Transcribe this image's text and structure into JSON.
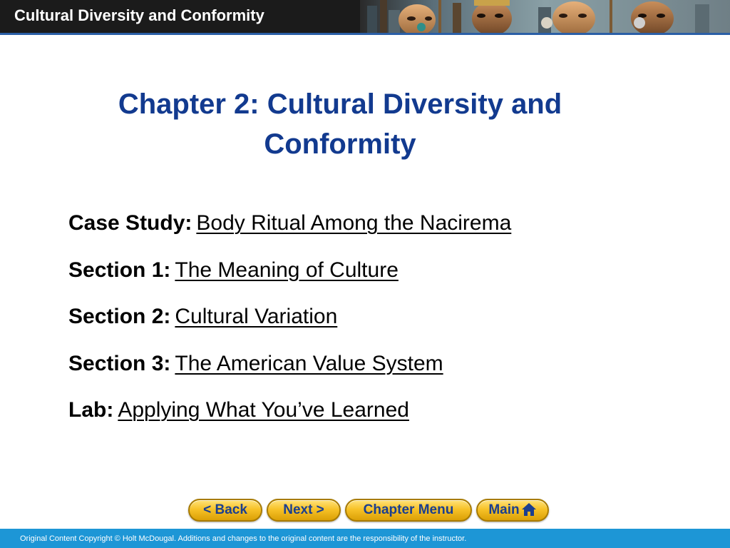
{
  "header": {
    "title": "Cultural Diversity and Conformity"
  },
  "slide": {
    "title": "Chapter 2: Cultural Diversity and Conformity"
  },
  "menu": [
    {
      "label": "Case Study:",
      "link": "Body Ritual Among the Nacirema"
    },
    {
      "label": "Section 1:",
      "link": "The Meaning of Culture"
    },
    {
      "label": "Section 2:",
      "link": "Cultural Variation"
    },
    {
      "label": "Section 3:",
      "link": "The American Value System"
    },
    {
      "label": "Lab:",
      "link": "Applying What You’ve Learned"
    }
  ],
  "nav": {
    "back_label": "< Back",
    "next_label": "Next >",
    "chapter_label": "Chapter Menu",
    "main_label": "Main"
  },
  "footer": {
    "copyright": "Original Content Copyright © Holt McDougal. Additions and changes to the original content are the responsibility of the instructor."
  },
  "colors": {
    "title": "#123a8f",
    "header_bg": "#1b1b1b",
    "footer_bg": "#1d96d6",
    "button_fill": "#f7c228",
    "button_text": "#1b3f8f"
  },
  "icons": {
    "main_button": "home-icon",
    "header_art": "decorative-faces-banner"
  }
}
